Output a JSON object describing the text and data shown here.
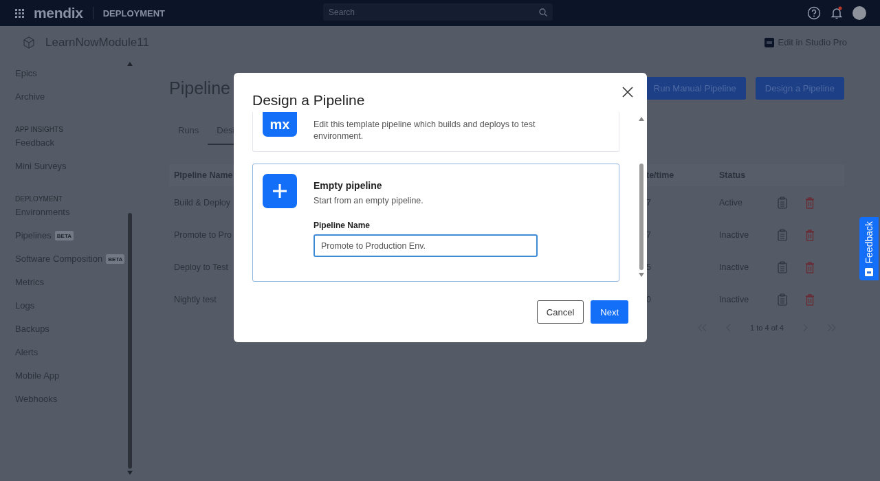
{
  "topbar": {
    "logo": "mendix",
    "product": "DEPLOYMENT",
    "search": {
      "placeholder": "Search"
    }
  },
  "app_header": {
    "app_name": "LearnNowModule11",
    "studio_link": "Edit in Studio Pro"
  },
  "sidebar": {
    "items": [
      {
        "kind": "item",
        "label": "Epics"
      },
      {
        "kind": "item",
        "label": "Archive"
      },
      {
        "kind": "heading",
        "label": "APP INSIGHTS"
      },
      {
        "kind": "item",
        "label": "Feedback"
      },
      {
        "kind": "item",
        "label": "Mini Surveys"
      },
      {
        "kind": "heading",
        "label": "DEPLOYMENT"
      },
      {
        "kind": "item",
        "label": "Environments"
      },
      {
        "kind": "item",
        "label": "Pipelines",
        "badge": "BETA"
      },
      {
        "kind": "item",
        "label": "Software Composition",
        "badge": "BETA"
      },
      {
        "kind": "item",
        "label": "Metrics"
      },
      {
        "kind": "item",
        "label": "Logs"
      },
      {
        "kind": "item",
        "label": "Backups"
      },
      {
        "kind": "item",
        "label": "Alerts"
      },
      {
        "kind": "item",
        "label": "Mobile App"
      },
      {
        "kind": "item",
        "label": "Webhooks"
      }
    ]
  },
  "page": {
    "title": "Pipeline",
    "actions": [
      "Run Manual Pipeline",
      "Design a Pipeline"
    ],
    "tabs": [
      {
        "label": "Runs",
        "selected": false
      },
      {
        "label": "Desi",
        "selected": true
      }
    ],
    "table": {
      "columns": [
        "Pipeline Name",
        "te/time",
        "Status"
      ],
      "rows": [
        {
          "name": "Build & Deploy",
          "column_2": "7",
          "status": "Active"
        },
        {
          "name": "Promote to Pro",
          "column_2": "7",
          "status": "Inactive"
        },
        {
          "name": "Deploy to Test",
          "column_2": "5",
          "status": "Inactive"
        },
        {
          "name": "Nightly test",
          "column_2": "0",
          "status": "Inactive"
        }
      ]
    },
    "pagination": {
      "label": "1 to 4 of 4"
    }
  },
  "feedback_tab": {
    "label": "Feedback"
  },
  "dialog": {
    "title": "Design a Pipeline",
    "options": [
      {
        "kind": "template",
        "badge": "mx",
        "description": "Edit this template pipeline which builds and deploys to test environment.",
        "selected": false
      },
      {
        "kind": "empty",
        "title": "Empty pipeline",
        "description": "Start from an empty pipeline.",
        "field_label": "Pipeline Name",
        "field_value": "Promote to Production Env.",
        "selected": true
      }
    ],
    "buttons": [
      {
        "label": "Cancel",
        "kind": "secondary"
      },
      {
        "label": "Next",
        "kind": "primary"
      }
    ]
  }
}
